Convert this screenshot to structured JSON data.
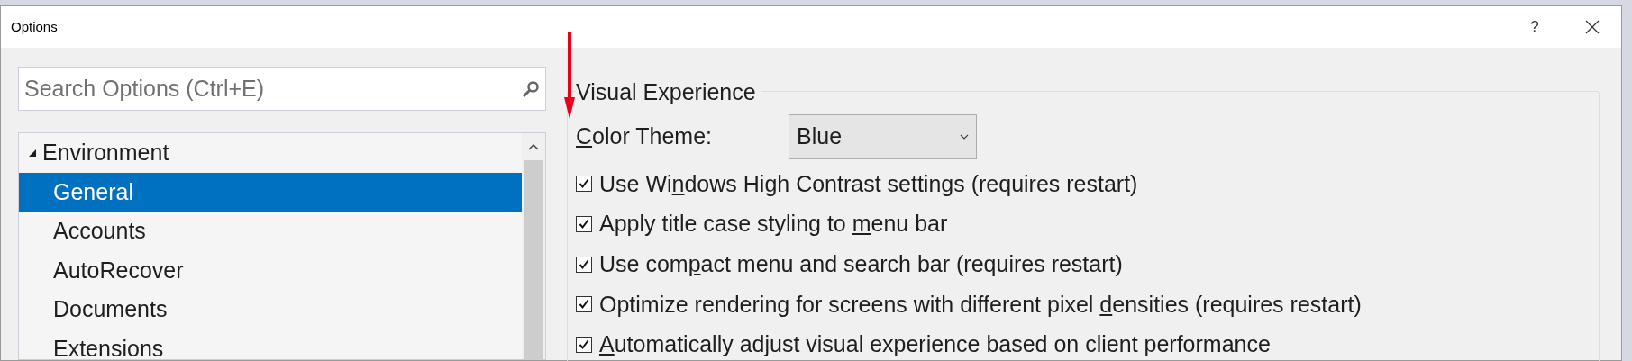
{
  "window": {
    "title": "Options",
    "help": "?"
  },
  "search": {
    "placeholder": "Search Options (Ctrl+E)"
  },
  "tree": [
    {
      "label": "Environment",
      "expanded": true,
      "selected": false,
      "children": [
        {
          "label": "General",
          "selected": true
        },
        {
          "label": "Accounts",
          "selected": false
        },
        {
          "label": "AutoRecover",
          "selected": false
        },
        {
          "label": "Documents",
          "selected": false
        },
        {
          "label": "Extensions",
          "selected": false
        }
      ]
    }
  ],
  "group": {
    "title": "Visual Experience",
    "color_theme": {
      "label": {
        "accel": "C",
        "after": "olor Theme:"
      },
      "value": "Blue"
    },
    "options": [
      {
        "before": "Use Wi",
        "accel": "n",
        "after": "dows High Contrast settings (requires restart)",
        "checked": true
      },
      {
        "before": "Apply title case styling to ",
        "accel": "m",
        "after": "enu bar",
        "checked": true
      },
      {
        "before": "Use com",
        "accel": "p",
        "after": "act menu and search bar (requires restart)",
        "checked": true
      },
      {
        "before": "Optimize rendering for screens with different pixel ",
        "accel": "d",
        "after": "ensities (requires restart)",
        "checked": true
      },
      {
        "accel": "A",
        "after": "utomatically adjust visual experience based on client performance",
        "checked": true
      }
    ]
  }
}
